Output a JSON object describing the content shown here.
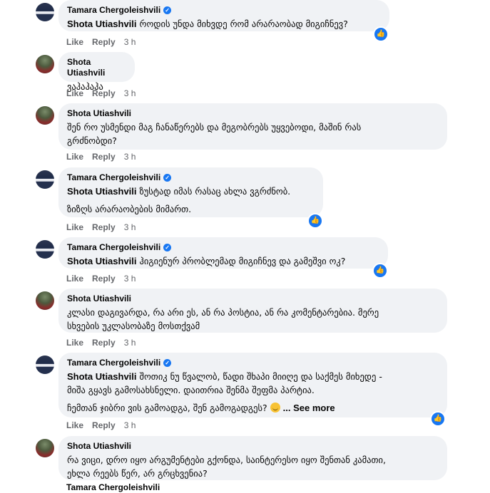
{
  "comments": [
    {
      "author": "Tamara Chergoleishvili",
      "verified": true,
      "mention": "Shota Utiashvili",
      "text_lines": [
        "როდის უნდა მიხვდე რომ არარაობად მიგიჩნევ?"
      ],
      "actions": {
        "like": "Like",
        "reply": "Reply",
        "time": "3 h"
      },
      "reaction": "like"
    },
    {
      "author": "Shota Utiashvili",
      "verified": false,
      "mention": "",
      "text_lines": [
        "ვაჰაჰაჰა"
      ],
      "actions": {
        "like": "Like",
        "reply": "Reply",
        "time": "3 h"
      }
    },
    {
      "author": "Shota Utiashvili",
      "verified": false,
      "mention": "",
      "text_lines": [
        "შენ რო უსმენდი მაგ ჩანაწერებს და მეგობრებს უყვებოდი, მაშინ რას",
        "გრძნობდი?"
      ],
      "actions": {
        "like": "Like",
        "reply": "Reply",
        "time": "3 h"
      }
    },
    {
      "author": "Tamara Chergoleishvili",
      "verified": true,
      "mention": "Shota Utiashvili",
      "text_lines": [
        "ზუსტად იმას რასაც ახლა ვგრძნობ."
      ],
      "text_para2": "ზიზღს არარაობების მიმართ.",
      "actions": {
        "like": "Like",
        "reply": "Reply",
        "time": "3 h"
      },
      "reaction": "like"
    },
    {
      "author": "Tamara Chergoleishvili",
      "verified": true,
      "mention": "Shota Utiashvili",
      "text_lines": [
        "ჰიგიენურ პრობლემად მიგიჩნევ და გამეშვი ოკ?"
      ],
      "actions": {
        "like": "Like",
        "reply": "Reply",
        "time": "3 h"
      },
      "reaction": "like"
    },
    {
      "author": "Shota Utiashvili",
      "verified": false,
      "mention": "",
      "text_lines": [
        "კლასი დაგივარდა, რა არი ეს, ან რა პოსტია, ან რა კომენტარებია. მერე",
        "სხვების უკლასობაზე მოსთქვამ"
      ],
      "actions": {
        "like": "Like",
        "reply": "Reply",
        "time": "3 h"
      }
    },
    {
      "author": "Tamara Chergoleishvili",
      "verified": true,
      "mention": "Shota Utiashvili",
      "text_lines": [
        "შოთიკ ნუ წვალობ, წადი შხაპი მიიღე და საქმეს მიხედე -",
        "მიშა გყავს გამოსახსნელი. დაითრია შენმა შეფმა პარტია."
      ],
      "text_para2": "ჩემთან ჯიბრი ვის გამოადგა, შენ გამოგადგეს?",
      "see_more": "... See more",
      "actions": {
        "like": "Like",
        "reply": "Reply",
        "time": "3 h"
      },
      "reaction": "like"
    },
    {
      "author": "Shota Utiashvili",
      "verified": false,
      "mention": "",
      "text_lines": [
        "რა ვიცი, დრო იყო არგუმენტები გქონდა, საინტერესო იყო შენთან კამათი,",
        "ეხლა რეებს წერ, არ გრცხვენია?"
      ],
      "actions": {
        "like": "Like",
        "reply": "Reply",
        "time": "3 h"
      }
    },
    {
      "author": "Tamara Chergoleishvili",
      "verified": true,
      "partial": true
    }
  ]
}
